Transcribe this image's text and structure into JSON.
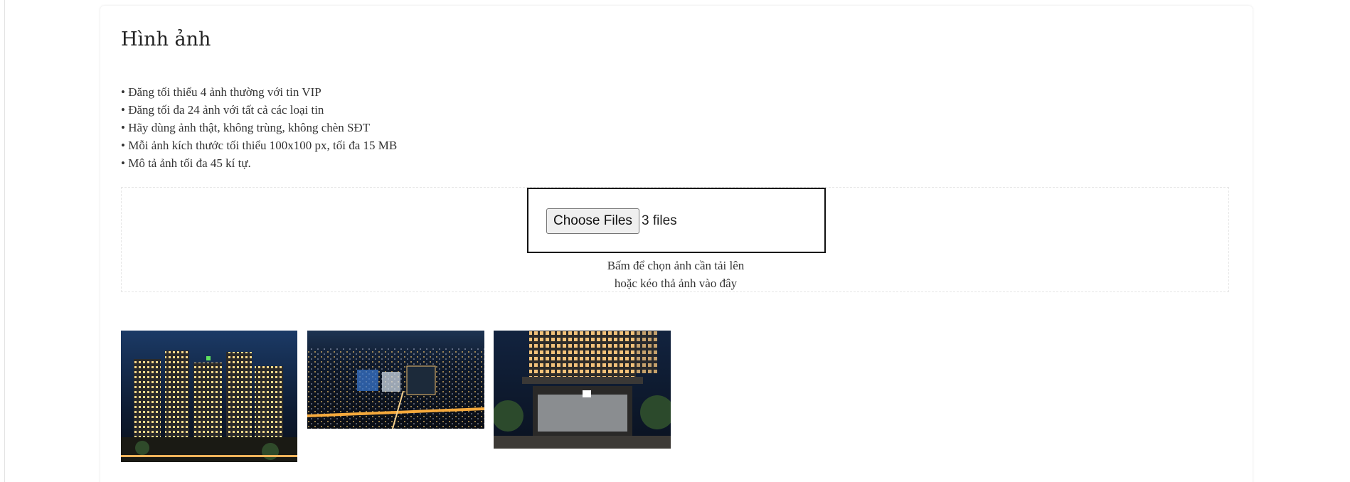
{
  "section": {
    "title": "Hình ảnh"
  },
  "rules": [
    "Đăng tối thiểu 4 ảnh thường với tin VIP",
    "Đăng tối đa 24 ảnh với tất cả các loại tin",
    "Hãy dùng ảnh thật, không trùng, không chèn SĐT",
    "Mỗi ảnh kích thước tối thiểu 100x100 px, tối đa 15 MB",
    "Mô tả ảnh tối đa 45 kí tự."
  ],
  "upload": {
    "button_label": "Choose Files",
    "file_status": "3 files",
    "hint_line1": "Bấm để chọn ảnh cần tải lên",
    "hint_line2": "hoặc kéo thả ảnh vào đây"
  },
  "thumbnails": [
    {
      "name": "night-apartment-towers",
      "alt": "Apartment towers at night"
    },
    {
      "name": "aerial-city-night",
      "alt": "Aerial city view at night"
    },
    {
      "name": "building-entrance-night",
      "alt": "Building entrance at night"
    }
  ],
  "colors": {
    "card_border": "#e6e6e6",
    "file_box_border": "#111111",
    "button_bg": "#efefef",
    "night_sky": "#0d1a33"
  }
}
